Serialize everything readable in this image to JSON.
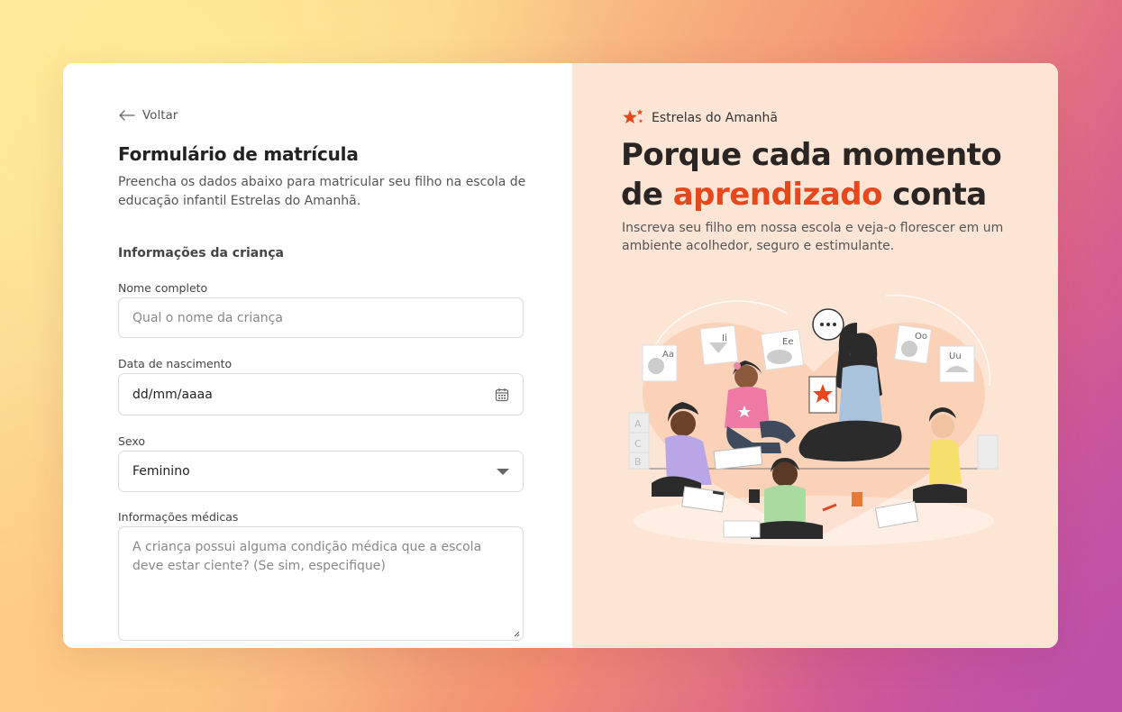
{
  "form": {
    "back_label": "Voltar",
    "title": "Formulário de matrícula",
    "description": "Preencha os dados abaixo para matricular seu filho na escola de educação infantil Estrelas do Amanhã.",
    "section_child": "Informações da criança",
    "name_label": "Nome completo",
    "name_placeholder": "Qual o nome da criança",
    "birth_label": "Data de nascimento",
    "birth_value": "dd/mm/aaaa",
    "sex_label": "Sexo",
    "sex_value": "Feminino",
    "medical_label": "Informações médicas",
    "medical_placeholder": "A criança possui alguma condição médica que a escola deve estar ciente? (Se sim, especifique)"
  },
  "promo": {
    "brand_name": "Estrelas do Amanhã",
    "headline_part1": "Porque cada momento de ",
    "headline_accent": "aprendizado",
    "headline_part2": " conta",
    "subtitle": "Inscreva seu filho em nossa escola e veja-o florescer em um ambiente acolhedor, seguro e estimulante.",
    "flashcards": [
      "Aa",
      "Ii",
      "Ee",
      "Oo",
      "Uu"
    ],
    "blocks": [
      "A",
      "C",
      "B"
    ]
  },
  "colors": {
    "accent": "#e8471e",
    "panel_bg": "#fde5d6"
  },
  "icons": {
    "back": "arrow-left-icon",
    "calendar": "calendar-icon",
    "select": "chevron-down-icon",
    "brand": "star-logo-icon"
  }
}
